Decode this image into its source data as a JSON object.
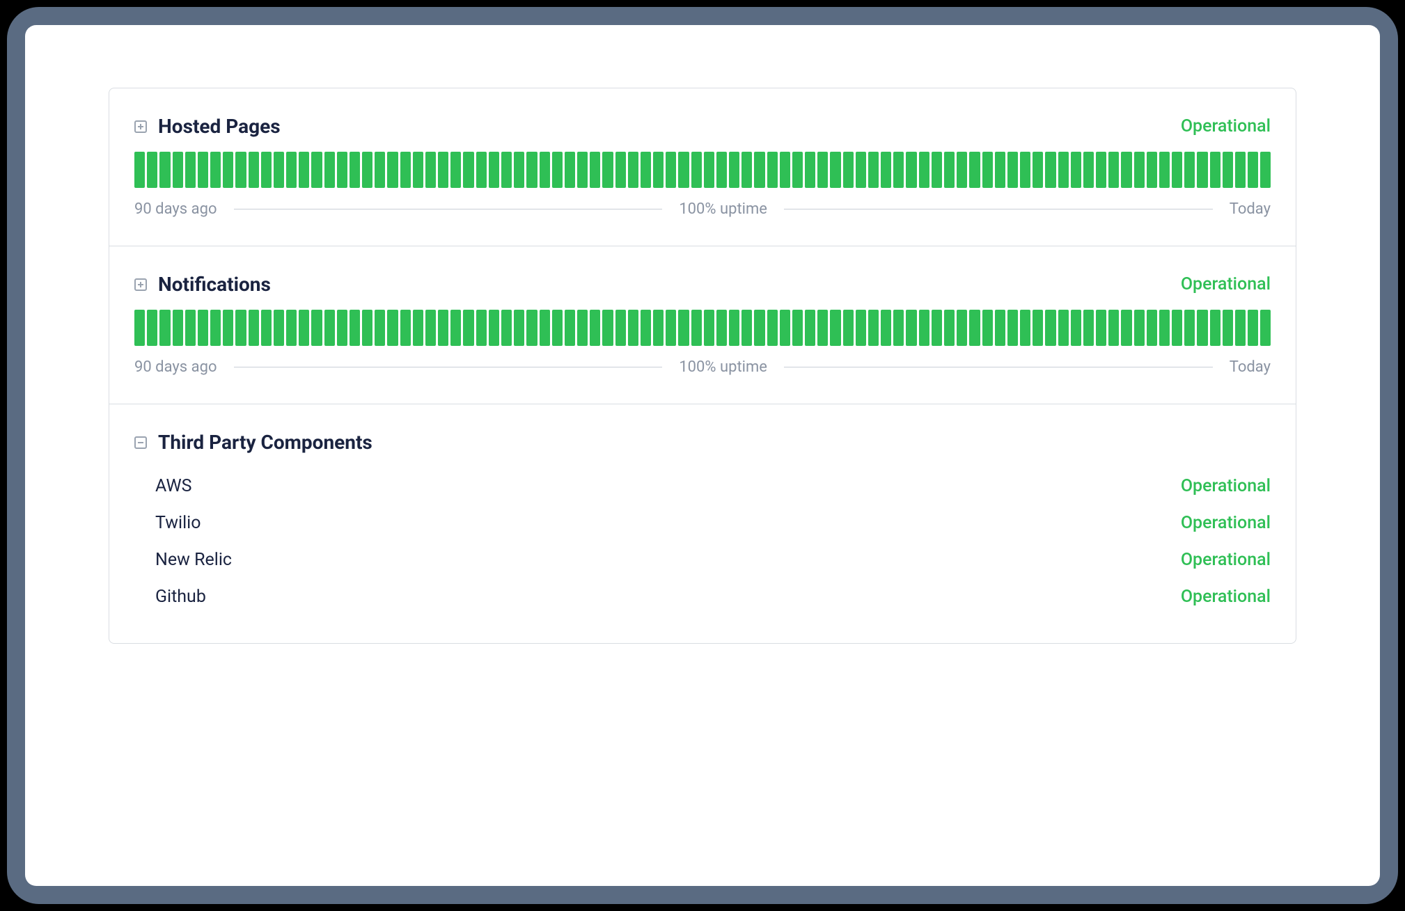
{
  "sections": [
    {
      "title": "Hosted Pages",
      "status": "Operational",
      "expanded": false,
      "uptime": {
        "left": "90 days ago",
        "center": "100% uptime",
        "right": "Today",
        "bars": 90
      }
    },
    {
      "title": "Notifications",
      "status": "Operational",
      "expanded": false,
      "uptime": {
        "left": "90 days ago",
        "center": "100% uptime",
        "right": "Today",
        "bars": 90
      }
    },
    {
      "title": "Third Party Components",
      "expanded": true,
      "items": [
        {
          "name": "AWS",
          "status": "Operational"
        },
        {
          "name": "Twilio",
          "status": "Operational"
        },
        {
          "name": "New Relic",
          "status": "Operational"
        },
        {
          "name": "Github",
          "status": "Operational"
        }
      ]
    }
  ],
  "colors": {
    "operational": "#2fbf55"
  }
}
